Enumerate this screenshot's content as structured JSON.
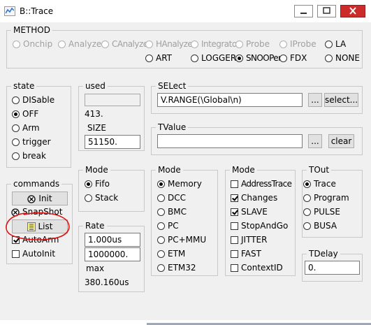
{
  "window": {
    "title": "B::Trace"
  },
  "method": {
    "label": "METHOD",
    "row1": [
      {
        "label": "Onchip",
        "selected": false,
        "enabled": false
      },
      {
        "label": "Analyzer",
        "selected": false,
        "enabled": false
      },
      {
        "label": "CAnalyzer",
        "selected": false,
        "enabled": false
      },
      {
        "label": "HAnalyzer",
        "selected": false,
        "enabled": false
      },
      {
        "label": "Integrator",
        "selected": false,
        "enabled": false
      },
      {
        "label": "Probe",
        "selected": false,
        "enabled": false
      },
      {
        "label": "IProbe",
        "selected": false,
        "enabled": false
      },
      {
        "label": "LA",
        "selected": false,
        "enabled": true
      }
    ],
    "row2": [
      {
        "label": "ART",
        "selected": false
      },
      {
        "label": "LOGGER",
        "selected": false
      },
      {
        "label": "SNOOPer",
        "selected": true
      },
      {
        "label": "FDX",
        "selected": false
      },
      {
        "label": "NONE",
        "selected": false
      }
    ]
  },
  "state": {
    "label": "state",
    "options": [
      {
        "label": "DISable",
        "selected": false
      },
      {
        "label": "OFF",
        "selected": true
      },
      {
        "label": "Arm",
        "selected": false
      },
      {
        "label": "trigger",
        "selected": false
      },
      {
        "label": "break",
        "selected": false
      }
    ]
  },
  "used": {
    "label": "used",
    "value": "413."
  },
  "size": {
    "label": "SIZE",
    "value": "51150."
  },
  "select": {
    "label": "SELect",
    "value": "V.RANGE(\\Global\\n)",
    "dots": "...",
    "button": "select..."
  },
  "tvalue": {
    "label": "TValue",
    "value": "",
    "dots": "...",
    "button": "clear"
  },
  "commands": {
    "label": "commands",
    "init": "Init",
    "snapshot": "SnapShot",
    "list": "List",
    "autoarm": {
      "label": "AutoArm",
      "checked": true
    },
    "autoinit": {
      "label": "AutoInit",
      "checked": false
    }
  },
  "mode1": {
    "label": "Mode",
    "options": [
      {
        "label": "Fifo",
        "selected": true
      },
      {
        "label": "Stack",
        "selected": false
      }
    ]
  },
  "rate": {
    "label": "Rate",
    "value1": "1.000us",
    "value2": "1000000.",
    "max_label": "max",
    "max_value": "380.160us"
  },
  "mode2": {
    "label": "Mode",
    "options": [
      {
        "label": "Memory",
        "selected": true
      },
      {
        "label": "DCC",
        "selected": false
      },
      {
        "label": "BMC",
        "selected": false
      },
      {
        "label": "PC",
        "selected": false
      },
      {
        "label": "PC+MMU",
        "selected": false
      },
      {
        "label": "ETM",
        "selected": false
      },
      {
        "label": "ETM32",
        "selected": false
      }
    ]
  },
  "mode3": {
    "label": "Mode",
    "options": [
      {
        "label": "AddressTrace",
        "checked": false
      },
      {
        "label": "Changes",
        "checked": true
      },
      {
        "label": "SLAVE",
        "checked": true
      },
      {
        "label": "StopAndGo",
        "checked": false
      },
      {
        "label": "JITTER",
        "checked": false
      },
      {
        "label": "FAST",
        "checked": false
      },
      {
        "label": "ContextID",
        "checked": false
      }
    ]
  },
  "tout": {
    "label": "TOut",
    "options": [
      {
        "label": "Trace",
        "selected": true
      },
      {
        "label": "Program",
        "selected": false
      },
      {
        "label": "PULSE",
        "selected": false
      },
      {
        "label": "BUSA",
        "selected": false
      }
    ]
  },
  "tdelay": {
    "label": "TDelay",
    "value": "0."
  },
  "colors": {
    "annotation": "#e01010",
    "background": "#f0f0f0",
    "close": "#cc2b2b"
  }
}
